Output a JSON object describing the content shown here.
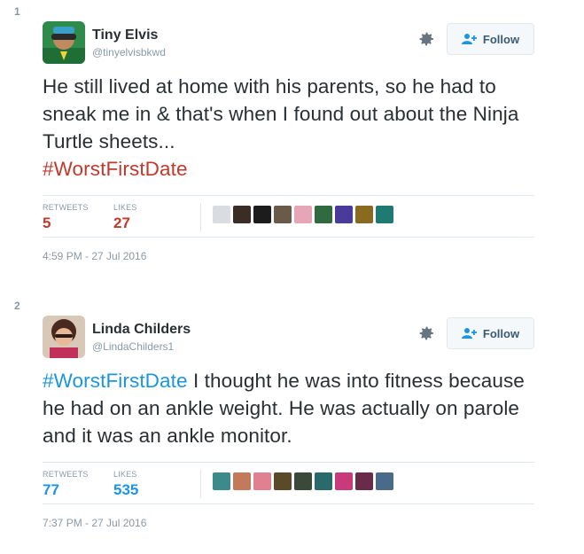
{
  "tweets": [
    {
      "number": "1",
      "name": "Tiny Elvis",
      "handle": "@tinyelvisbkwd",
      "follow_label": "Follow",
      "text_plain": "He still lived at home with his parents, so he had to sneak me in & that's when I found out about the Ninja Turtle sheets...",
      "hashtag": "#WorstFirstDate",
      "retweets_label": "RETWEETS",
      "retweets": "5",
      "likes_label": "LIKES",
      "likes": "27",
      "timestamp": "4:59 PM - 27 Jul 2016",
      "liker_colors": [
        "#d9dde1",
        "#3a2d26",
        "#1c1c1c",
        "#6a5a4a",
        "#e6a6b8",
        "#2f6b3e",
        "#4a3a9a",
        "#8a6a20",
        "#1e7a73"
      ]
    },
    {
      "number": "2",
      "name": "Linda Childers",
      "handle": "@LindaChilders1",
      "follow_label": "Follow",
      "hashtag": "#WorstFirstDate",
      "text_plain": " I thought he was into fitness because he had on an ankle weight. He was actually on parole and it was an ankle monitor.",
      "retweets_label": "RETWEETS",
      "retweets": "77",
      "likes_label": "LIKES",
      "likes": "535",
      "timestamp": "7:37 PM - 27 Jul 2016",
      "liker_colors": [
        "#3d8a8a",
        "#c47a5a",
        "#e08090",
        "#5a4a2a",
        "#3a4a3a",
        "#2a6a6a",
        "#c83a7a",
        "#6a2a4a",
        "#4a6a8a"
      ]
    }
  ],
  "colors": {
    "accent": "#1b95e0",
    "hashtag_red": "#c0392b",
    "muted": "#8899a6"
  },
  "icons": {
    "gear": "gear-icon",
    "follow": "add-user-icon"
  }
}
